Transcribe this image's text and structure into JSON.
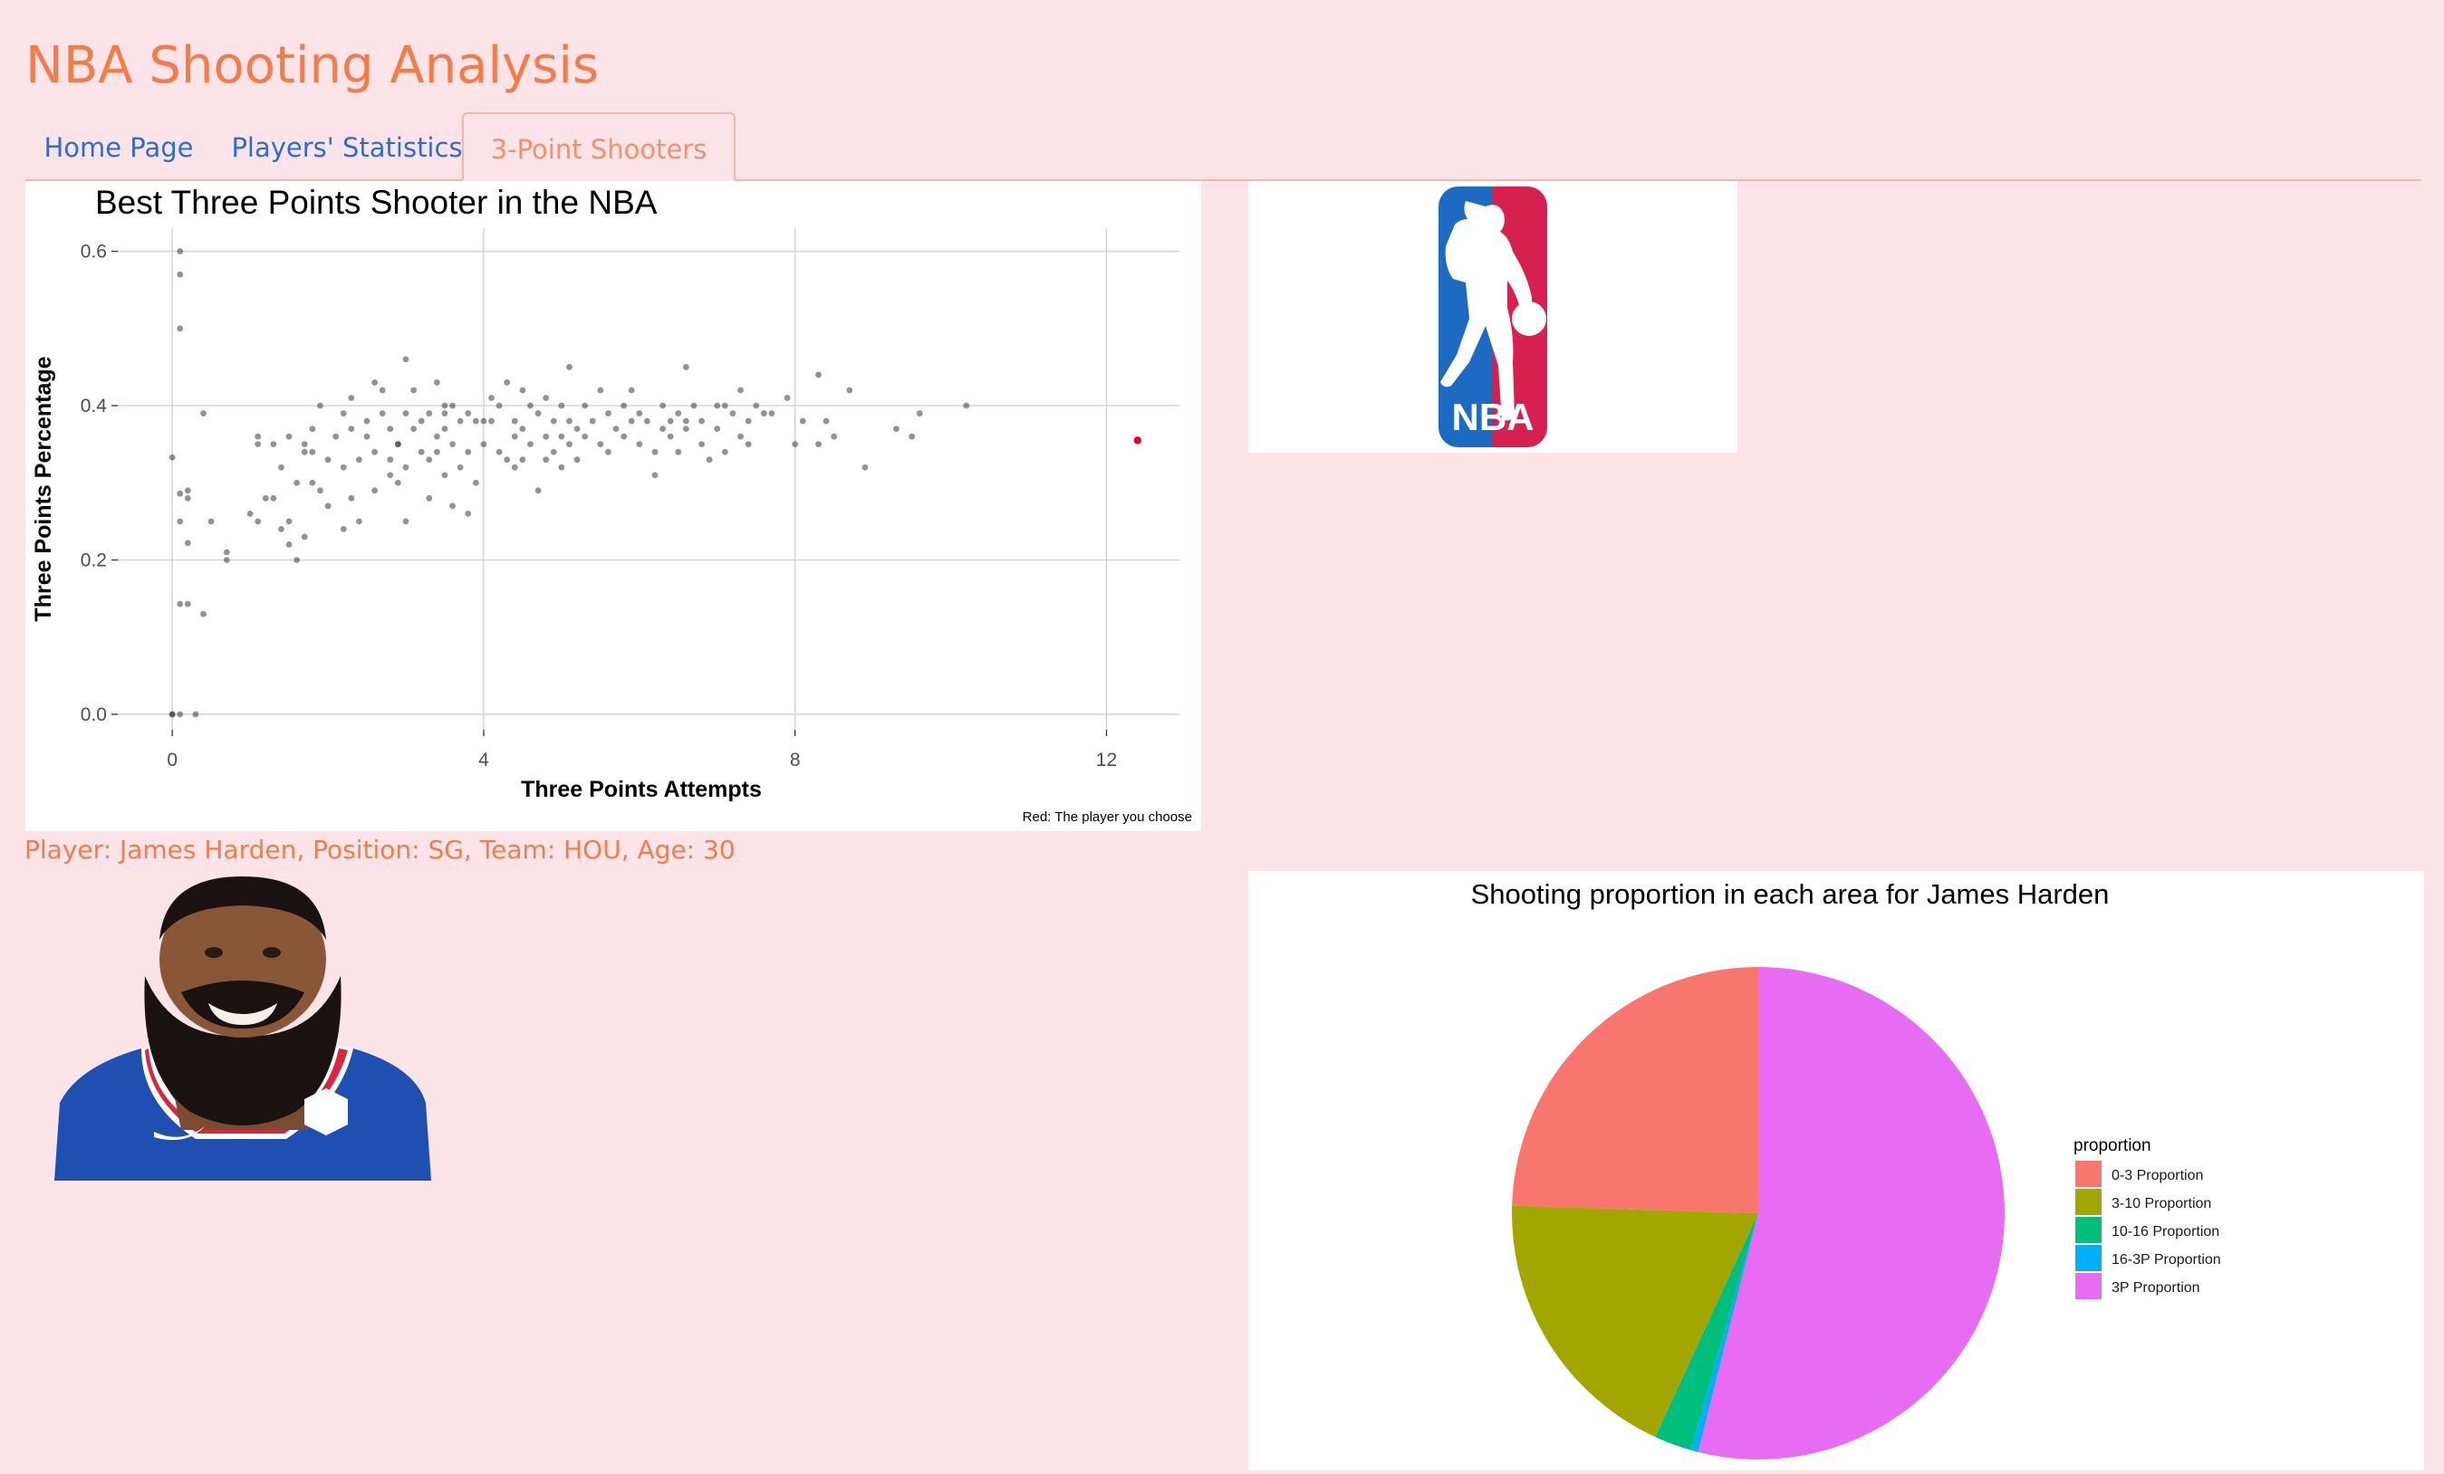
{
  "app": {
    "title": "NBA Shooting Analysis"
  },
  "tabs": [
    {
      "label": "Home Page",
      "active": false
    },
    {
      "label": "Players' Statistics",
      "active": false
    },
    {
      "label": "3-Point Shooters",
      "active": true
    }
  ],
  "player_info": "Player: James Harden, Position: SG, Team: HOU, Age: 30",
  "logo": {
    "text": "NBA",
    "colors": {
      "left": "#1d6ac2",
      "right": "#d6204f"
    }
  },
  "colors": {
    "accent": "#f47c48",
    "tab_link": "#2a6dd9",
    "page_bg": "#fde4e9",
    "highlight_point": "#e8001c"
  },
  "chart_data": [
    {
      "type": "scatter",
      "title": "Best Three Points Shooter in the NBA",
      "xlabel": "Three Points Attempts",
      "ylabel": "Three Points Percentage",
      "caption": "Red: The player you choose",
      "xlim": [
        -0.7,
        13.1
      ],
      "ylim": [
        -0.02,
        0.63
      ],
      "xticks": [
        0,
        4,
        8,
        12
      ],
      "yticks": [
        0.0,
        0.2,
        0.4,
        0.6
      ],
      "ytick_labels": [
        "0.0",
        "0.2",
        "0.4",
        "0.6"
      ],
      "grid": true,
      "highlight": {
        "x": 12.4,
        "y": 0.355,
        "color": "#e8001c"
      },
      "series": [
        {
          "points": [
            [
              0.0,
              0.0
            ],
            [
              0.0,
              0.0
            ],
            [
              0.1,
              0.0
            ],
            [
              0.3,
              0.0
            ],
            [
              0.0,
              0.333
            ],
            [
              0.1,
              0.6
            ],
            [
              0.1,
              0.57
            ],
            [
              0.1,
              0.5
            ],
            [
              0.1,
              0.143
            ],
            [
              0.2,
              0.143
            ],
            [
              0.1,
              0.286
            ],
            [
              0.2,
              0.29
            ],
            [
              0.2,
              0.28
            ],
            [
              0.1,
              0.25
            ],
            [
              0.2,
              0.222
            ],
            [
              0.4,
              0.13
            ],
            [
              0.5,
              0.25
            ],
            [
              0.4,
              0.39
            ],
            [
              0.7,
              0.2
            ],
            [
              0.7,
              0.21
            ],
            [
              1.0,
              0.26
            ],
            [
              1.1,
              0.25
            ],
            [
              1.1,
              0.35
            ],
            [
              1.1,
              0.36
            ],
            [
              1.2,
              0.28
            ],
            [
              1.3,
              0.28
            ],
            [
              1.3,
              0.35
            ],
            [
              1.4,
              0.24
            ],
            [
              1.5,
              0.36
            ],
            [
              1.5,
              0.25
            ],
            [
              1.5,
              0.22
            ],
            [
              1.6,
              0.2
            ],
            [
              1.6,
              0.3
            ],
            [
              1.7,
              0.23
            ],
            [
              1.7,
              0.34
            ],
            [
              1.7,
              0.35
            ],
            [
              1.8,
              0.34
            ],
            [
              1.8,
              0.37
            ],
            [
              1.9,
              0.29
            ],
            [
              1.9,
              0.4
            ],
            [
              2.0,
              0.27
            ],
            [
              2.0,
              0.33
            ],
            [
              2.1,
              0.36
            ],
            [
              2.2,
              0.24
            ],
            [
              2.2,
              0.32
            ],
            [
              2.2,
              0.39
            ],
            [
              2.3,
              0.41
            ],
            [
              2.3,
              0.28
            ],
            [
              2.4,
              0.25
            ],
            [
              2.4,
              0.33
            ],
            [
              2.5,
              0.38
            ],
            [
              2.5,
              0.36
            ],
            [
              2.6,
              0.34
            ],
            [
              2.6,
              0.29
            ],
            [
              2.6,
              0.43
            ],
            [
              2.7,
              0.42
            ],
            [
              2.7,
              0.39
            ],
            [
              2.8,
              0.37
            ],
            [
              2.8,
              0.31
            ],
            [
              2.8,
              0.33
            ],
            [
              2.9,
              0.35
            ],
            [
              2.9,
              0.3
            ],
            [
              3.0,
              0.39
            ],
            [
              3.0,
              0.25
            ],
            [
              3.0,
              0.46
            ],
            [
              3.0,
              0.32
            ],
            [
              3.1,
              0.37
            ],
            [
              3.1,
              0.42
            ],
            [
              3.2,
              0.34
            ],
            [
              3.2,
              0.38
            ],
            [
              3.3,
              0.33
            ],
            [
              3.3,
              0.39
            ],
            [
              3.3,
              0.28
            ],
            [
              3.4,
              0.36
            ],
            [
              3.4,
              0.43
            ],
            [
              3.4,
              0.34
            ],
            [
              3.5,
              0.39
            ],
            [
              3.5,
              0.31
            ],
            [
              3.5,
              0.37
            ],
            [
              3.6,
              0.35
            ],
            [
              3.6,
              0.27
            ],
            [
              3.6,
              0.4
            ],
            [
              3.7,
              0.32
            ],
            [
              3.7,
              0.38
            ],
            [
              3.8,
              0.26
            ],
            [
              3.8,
              0.34
            ],
            [
              3.8,
              0.39
            ],
            [
              3.9,
              0.38
            ],
            [
              3.9,
              0.3
            ],
            [
              4.0,
              0.38
            ],
            [
              4.0,
              0.35
            ],
            [
              4.1,
              0.41
            ],
            [
              4.1,
              0.38
            ],
            [
              4.2,
              0.34
            ],
            [
              4.2,
              0.4
            ],
            [
              4.3,
              0.33
            ],
            [
              4.3,
              0.43
            ],
            [
              4.4,
              0.36
            ],
            [
              4.4,
              0.38
            ],
            [
              4.5,
              0.42
            ],
            [
              4.5,
              0.37
            ],
            [
              4.5,
              0.33
            ],
            [
              4.6,
              0.4
            ],
            [
              4.6,
              0.35
            ],
            [
              4.7,
              0.29
            ],
            [
              4.7,
              0.39
            ],
            [
              4.8,
              0.33
            ],
            [
              4.8,
              0.41
            ],
            [
              4.8,
              0.36
            ],
            [
              4.9,
              0.34
            ],
            [
              4.9,
              0.38
            ],
            [
              5.0,
              0.32
            ],
            [
              5.0,
              0.36
            ],
            [
              5.0,
              0.4
            ],
            [
              5.1,
              0.35
            ],
            [
              5.1,
              0.45
            ],
            [
              5.1,
              0.38
            ],
            [
              5.2,
              0.33
            ],
            [
              5.3,
              0.4
            ],
            [
              5.3,
              0.36
            ],
            [
              5.4,
              0.38
            ],
            [
              5.5,
              0.42
            ],
            [
              5.5,
              0.35
            ],
            [
              5.6,
              0.39
            ],
            [
              5.6,
              0.34
            ],
            [
              5.7,
              0.37
            ],
            [
              5.8,
              0.4
            ],
            [
              5.8,
              0.36
            ],
            [
              5.9,
              0.38
            ],
            [
              5.9,
              0.42
            ],
            [
              6.0,
              0.35
            ],
            [
              6.0,
              0.39
            ],
            [
              6.1,
              0.38
            ],
            [
              6.2,
              0.34
            ],
            [
              6.2,
              0.31
            ],
            [
              6.3,
              0.37
            ],
            [
              6.3,
              0.4
            ],
            [
              6.4,
              0.36
            ],
            [
              6.5,
              0.39
            ],
            [
              6.5,
              0.34
            ],
            [
              6.6,
              0.45
            ],
            [
              6.6,
              0.37
            ],
            [
              6.7,
              0.4
            ],
            [
              6.8,
              0.38
            ],
            [
              6.8,
              0.35
            ],
            [
              6.9,
              0.33
            ],
            [
              7.0,
              0.4
            ],
            [
              7.0,
              0.37
            ],
            [
              7.1,
              0.34
            ],
            [
              7.1,
              0.4
            ],
            [
              7.2,
              0.39
            ],
            [
              7.3,
              0.36
            ],
            [
              7.3,
              0.42
            ],
            [
              7.4,
              0.38
            ],
            [
              7.4,
              0.35
            ],
            [
              7.5,
              0.4
            ],
            [
              7.6,
              0.39
            ],
            [
              7.9,
              0.41
            ],
            [
              8.0,
              0.35
            ],
            [
              8.1,
              0.38
            ],
            [
              8.3,
              0.35
            ],
            [
              8.3,
              0.44
            ],
            [
              8.4,
              0.38
            ],
            [
              8.5,
              0.36
            ],
            [
              8.7,
              0.42
            ],
            [
              8.9,
              0.32
            ],
            [
              9.3,
              0.37
            ],
            [
              9.5,
              0.36
            ],
            [
              9.6,
              0.39
            ],
            [
              10.2,
              0.4
            ],
            [
              6.6,
              0.38
            ],
            [
              5.2,
              0.37
            ],
            [
              4.4,
              0.32
            ],
            [
              3.5,
              0.4
            ],
            [
              2.9,
              0.35
            ],
            [
              2.3,
              0.37
            ],
            [
              1.8,
              0.3
            ],
            [
              1.4,
              0.32
            ],
            [
              6.4,
              0.38
            ],
            [
              7.7,
              0.39
            ]
          ]
        }
      ]
    },
    {
      "type": "pie",
      "title": "Shooting proportion in each area for James Harden",
      "legend_title": "proportion",
      "legend_position": "right",
      "categories": [
        "0-3 Proportion",
        "3-10 Proportion",
        "10-16 Proportion",
        "16-3P Proportion",
        "3P Proportion"
      ],
      "values": [
        0.25,
        0.19,
        0.025,
        0.005,
        0.55
      ],
      "colors": [
        "#f8766d",
        "#a3a500",
        "#00bf7d",
        "#00b0f6",
        "#e76bf3"
      ]
    }
  ]
}
